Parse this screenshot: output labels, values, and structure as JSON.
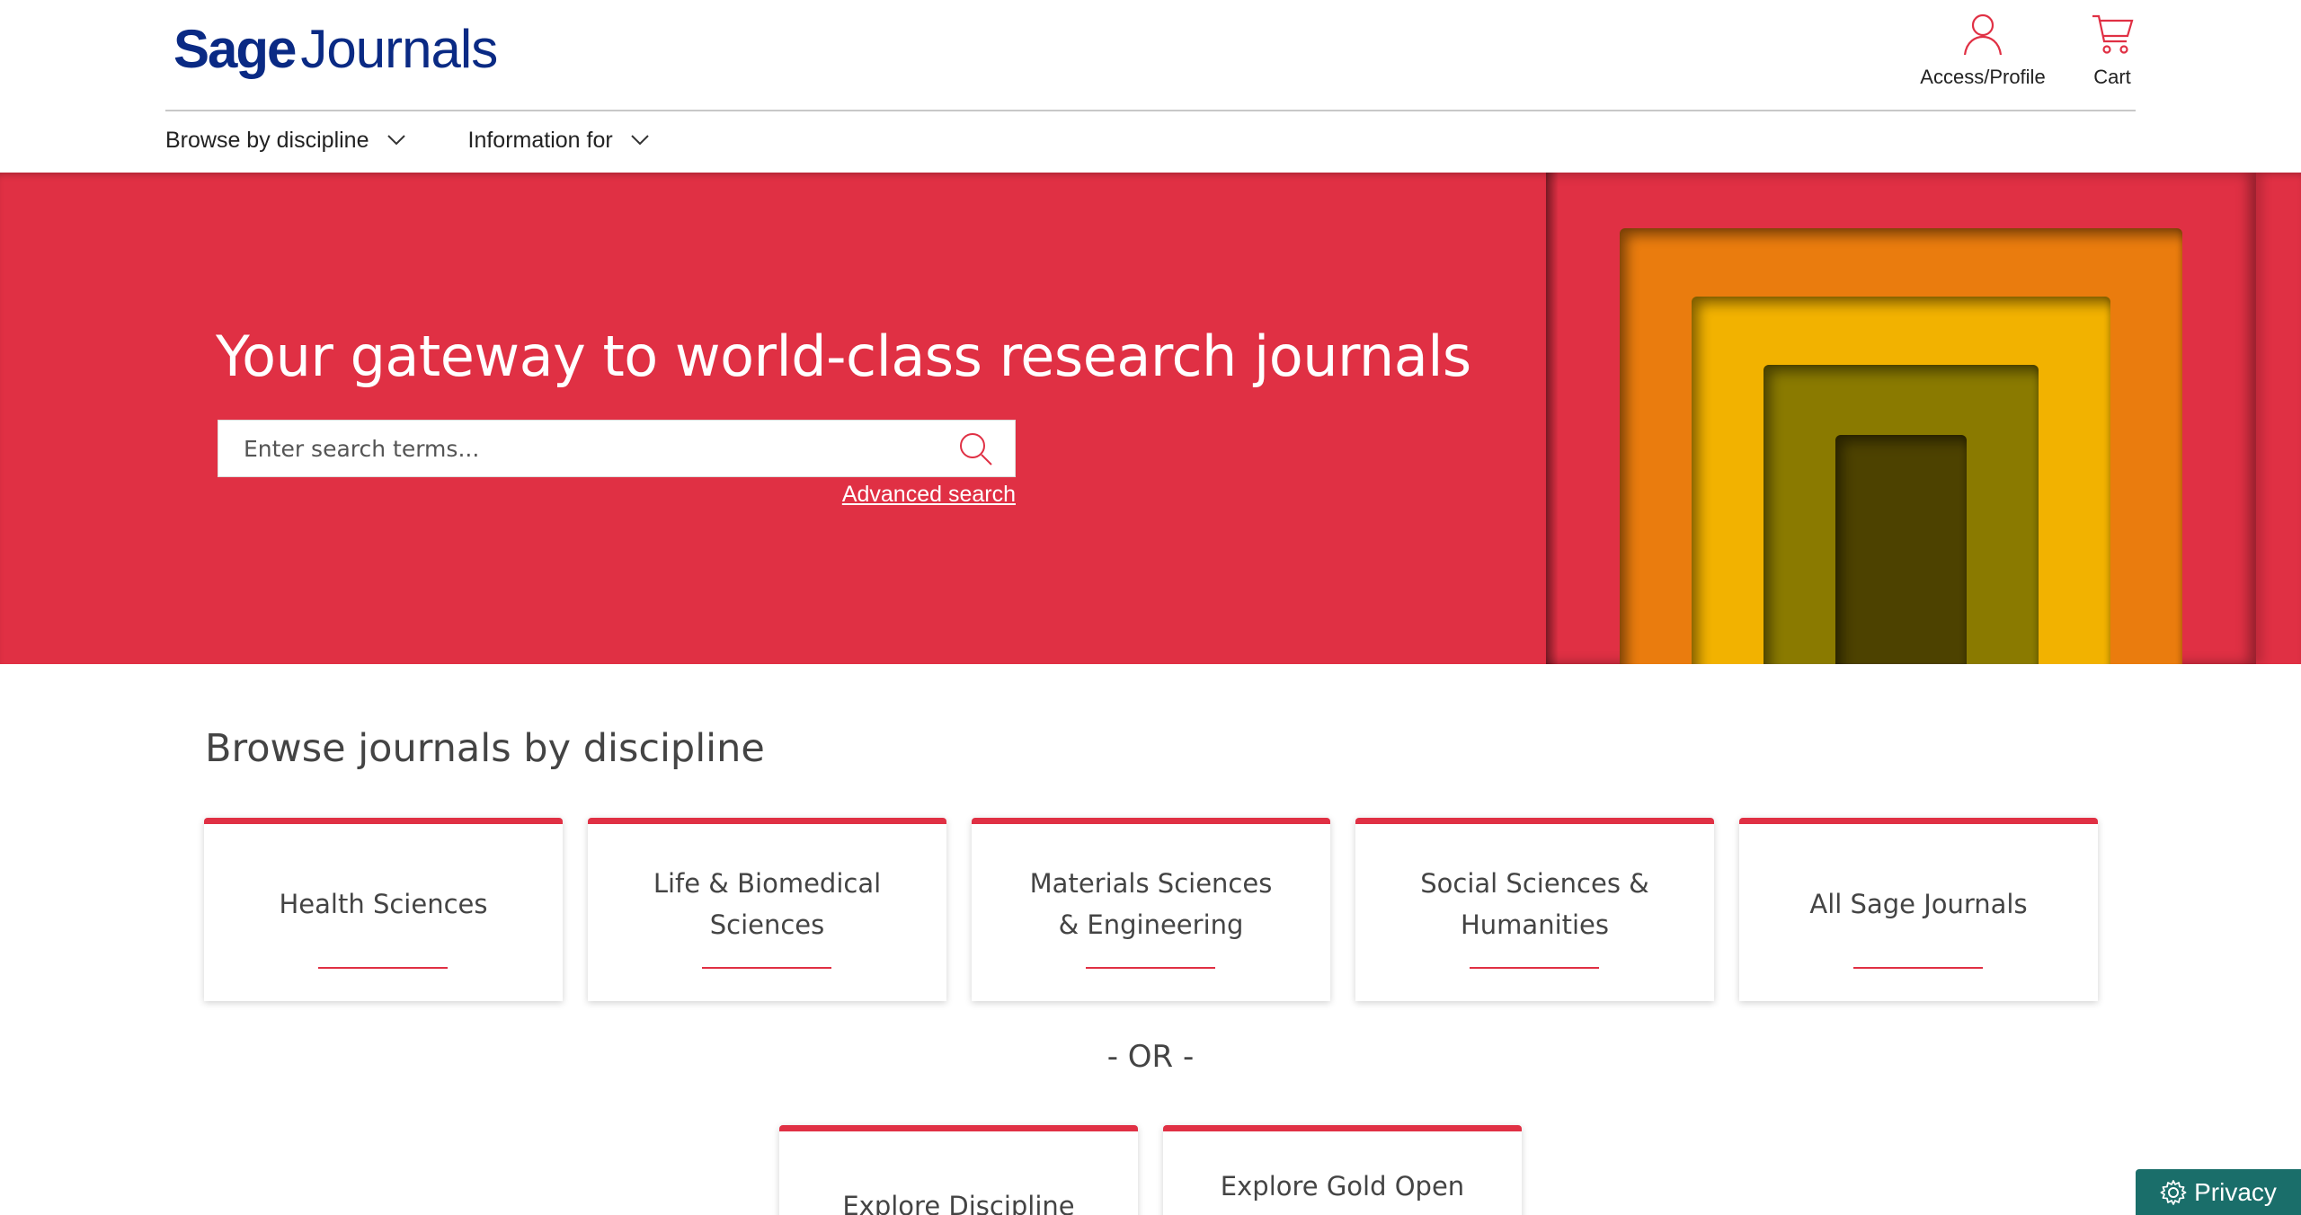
{
  "header": {
    "logo_sage": "Sage",
    "logo_journals": "Journals",
    "profile_label": "Access/Profile",
    "cart_label": "Cart",
    "brand_color": "#0a2a84",
    "accent_color": "#e03044"
  },
  "nav": {
    "items": [
      {
        "label": "Browse by discipline",
        "icon": "chevron-down-icon"
      },
      {
        "label": "Information for",
        "icon": "chevron-down-icon"
      }
    ]
  },
  "hero": {
    "title": "Your gateway to world-class research journals",
    "search_placeholder": "Enter search terms...",
    "search_icon": "search-icon",
    "advanced_search": "Advanced search"
  },
  "browse": {
    "title": "Browse journals by discipline",
    "cards": [
      {
        "label": "Health Sciences"
      },
      {
        "label": "Life & Biomedical Sciences"
      },
      {
        "label": "Materials Sciences & Engineering"
      },
      {
        "label": "Social Sciences & Humanities"
      },
      {
        "label": "All Sage Journals"
      }
    ],
    "or_text": "- OR -",
    "more_cards": [
      {
        "label": "Explore Discipline Hubs"
      },
      {
        "label": "Explore Gold Open"
      }
    ]
  },
  "privacy": {
    "label": "Privacy",
    "icon": "gear-icon",
    "color": "#1a6e6a"
  }
}
